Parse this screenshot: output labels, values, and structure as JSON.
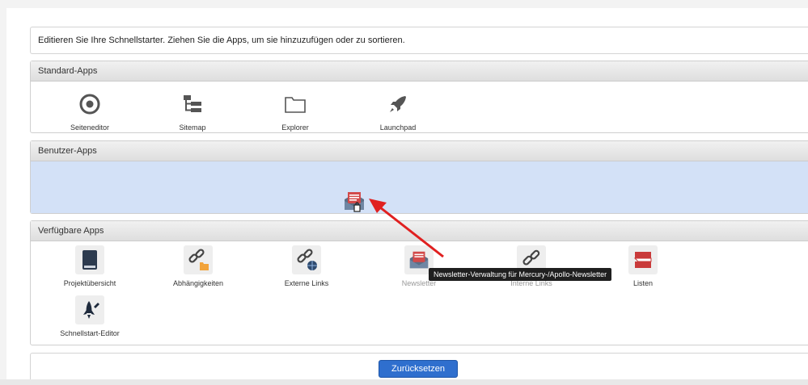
{
  "intro": {
    "text": "Editieren Sie Ihre Schnellstarter. Ziehen Sie die Apps, um sie hinzuzufügen oder zu sortieren."
  },
  "standard": {
    "title": "Standard-Apps",
    "apps": [
      {
        "label": "Seiteneditor",
        "icon": "target-icon"
      },
      {
        "label": "Sitemap",
        "icon": "sitemap-icon"
      },
      {
        "label": "Explorer",
        "icon": "folder-icon"
      },
      {
        "label": "Launchpad",
        "icon": "rocket-icon"
      }
    ]
  },
  "user": {
    "title": "Benutzer-Apps",
    "dragged_icon": "newsletter-icon"
  },
  "available": {
    "title": "Verfügbare Apps",
    "apps": [
      {
        "label": "Projektübersicht",
        "icon": "book-icon"
      },
      {
        "label": "Abhängigkeiten",
        "icon": "link-folder-icon"
      },
      {
        "label": "Externe Links",
        "icon": "link-globe-icon"
      },
      {
        "label": "Newsletter",
        "icon": "newsletter-icon"
      },
      {
        "label": "Interne Links",
        "icon": "link-icon"
      },
      {
        "label": "Listen",
        "icon": "list-book-icon"
      },
      {
        "label": "Schnellstart-Editor",
        "icon": "rocket-edit-icon"
      }
    ]
  },
  "tooltip": {
    "text": "Newsletter-Verwaltung für Mercury-/Apollo-Newsletter"
  },
  "footer": {
    "reset_label": "Zurücksetzen"
  },
  "colors": {
    "annotation_arrow": "#e02020",
    "user_drop_area": "#d3e1f7",
    "reset_button": "#2f6fce"
  }
}
